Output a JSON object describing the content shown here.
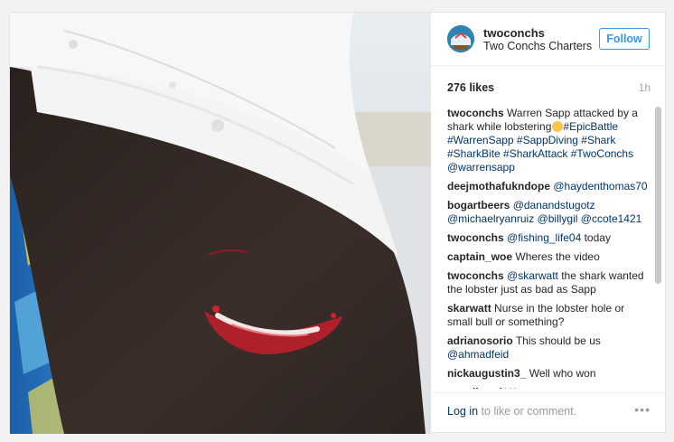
{
  "post": {
    "username": "twoconchs",
    "full_name": "Two Conchs Charters",
    "follow_label": "Follow",
    "likes": "276 likes",
    "time": "1h",
    "caption": {
      "user": "twoconchs",
      "text": "Warren Sapp attacked by a shark while lobstering",
      "hashtags": "#EpicBattle #WarrenSapp #SappDiving #Shark #SharkBite #SharkAttack #TwoConchs @warrensapp"
    },
    "comments": [
      {
        "user": "deejmothafukndope",
        "text": "@haydenthomas70"
      },
      {
        "user": "bogartbeers",
        "text": "@danandstugotz @michaelryanruiz @billygil @ccote1421"
      },
      {
        "user": "twoconchs",
        "text": "@fishing_life04 today"
      },
      {
        "user": "captain_woe",
        "text": "Wheres the video"
      },
      {
        "user": "twoconchs",
        "text": "@skarwatt the shark wanted the lobster just as bad as Sapp"
      },
      {
        "user": "skarwatt",
        "text": "Nurse in the lobster hole or small bull or something?"
      },
      {
        "user": "adrianosorio",
        "text": "This should be us @ahmadfeid"
      },
      {
        "user": "nickaugustin3_",
        "text": "Well who won"
      },
      {
        "user": "engelhood",
        "text": "Woww..."
      }
    ],
    "login_link": "Log in",
    "login_rest": "to like or comment.",
    "more": "•••"
  }
}
